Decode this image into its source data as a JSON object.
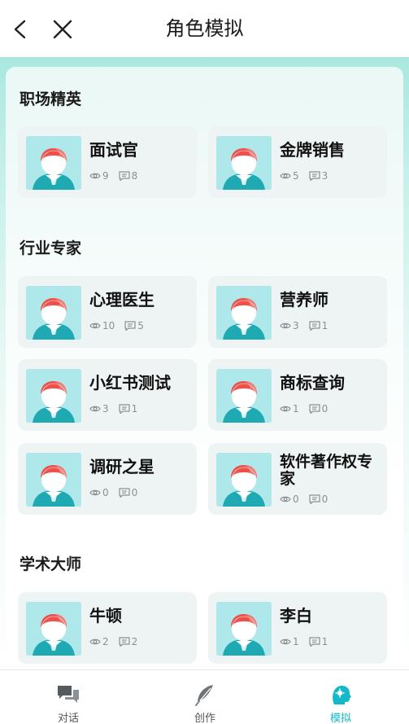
{
  "header": {
    "title": "角色模拟"
  },
  "sections": [
    {
      "title": "职场精英",
      "cards": [
        {
          "name": "面试官",
          "views": "9",
          "comments": "8"
        },
        {
          "name": "金牌销售",
          "views": "5",
          "comments": "3"
        }
      ]
    },
    {
      "title": "行业专家",
      "cards": [
        {
          "name": "心理医生",
          "views": "10",
          "comments": "5"
        },
        {
          "name": "营养师",
          "views": "3",
          "comments": "1"
        },
        {
          "name": "小红书测试",
          "views": "3",
          "comments": "1"
        },
        {
          "name": "商标查询",
          "views": "1",
          "comments": "0"
        },
        {
          "name": "调研之星",
          "views": "0",
          "comments": "0"
        },
        {
          "name": "软件著作权专家",
          "views": "0",
          "comments": "0"
        }
      ]
    },
    {
      "title": "学术大师",
      "cards": [
        {
          "name": "牛顿",
          "views": "2",
          "comments": "2"
        },
        {
          "name": "李白",
          "views": "1",
          "comments": "1"
        }
      ]
    }
  ],
  "tabs": [
    {
      "label": "对话",
      "icon": "chat-bubbles-icon"
    },
    {
      "label": "创作",
      "icon": "feather-icon"
    },
    {
      "label": "模拟",
      "icon": "profile-head-icon",
      "active": true
    }
  ],
  "colors": {
    "accent": "#13b9c6",
    "avatar_bg": "#aee8eb",
    "card_bg": "#eef4f4"
  }
}
